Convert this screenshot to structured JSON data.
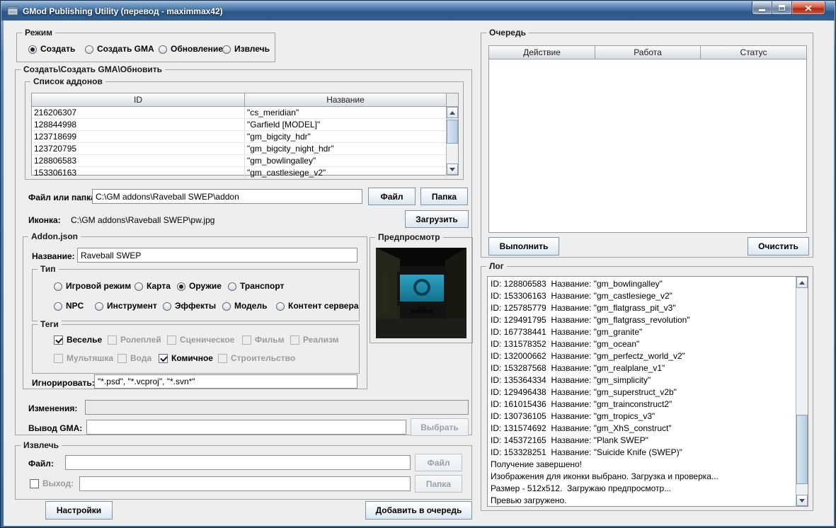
{
  "window": {
    "title": "GMod Publishing Utility (перевод - maximmax42)"
  },
  "colors": {
    "titlebar_blue": "#41709f",
    "close_red": "#c2402b",
    "panel": "#eeeeee",
    "accent_border": "#7e93a7",
    "scroll_thumb": "#b6cce3"
  },
  "mode": {
    "group_title": "Режим",
    "options": [
      {
        "label": "Создать",
        "selected": true
      },
      {
        "label": "Создать GMA",
        "selected": false
      },
      {
        "label": "Обновление",
        "selected": false
      },
      {
        "label": "Извлечь",
        "selected": false
      }
    ]
  },
  "create_section": {
    "group_title": "Создать\\Создать GMA\\Обновить",
    "addon_list": {
      "group_title": "Список аддонов",
      "columns": [
        "ID",
        "Название"
      ],
      "rows": [
        {
          "id": "216206307",
          "name": "\"cs_meridian\""
        },
        {
          "id": "128844998",
          "name": "\"Garfield [MODEL]\""
        },
        {
          "id": "123718699",
          "name": "\"gm_bigcity_hdr\""
        },
        {
          "id": "123720795",
          "name": "\"gm_bigcity_night_hdr\""
        },
        {
          "id": "128806583",
          "name": "\"gm_bowlingalley\""
        },
        {
          "id": "153306163",
          "name": "\"gm_castlesiege_v2\""
        }
      ]
    },
    "file_or_folder": {
      "label": "Файл или папка:",
      "value": "C:\\GM addons\\Raveball SWEP\\addon",
      "file_button": "Файл",
      "folder_button": "Папка"
    },
    "icon": {
      "label": "Иконка:",
      "value": "C:\\GM addons\\Raveball SWEP\\pw.jpg",
      "load_button": "Загрузить"
    },
    "addon_json": {
      "group_title": "Addon.json",
      "name_label": "Название:",
      "name_value": "Raveball SWEP",
      "type": {
        "group_title": "Тип",
        "row1": [
          {
            "label": "Игровой режим",
            "selected": false
          },
          {
            "label": "Карта",
            "selected": false
          },
          {
            "label": "Оружие",
            "selected": true
          },
          {
            "label": "Транспорт",
            "selected": false
          }
        ],
        "row2": [
          {
            "label": "NPC",
            "selected": false
          },
          {
            "label": "Инструмент",
            "selected": false
          },
          {
            "label": "Эффекты",
            "selected": false
          },
          {
            "label": "Модель",
            "selected": false
          },
          {
            "label": "Контент сервера",
            "selected": false
          }
        ]
      },
      "tags": {
        "group_title": "Теги",
        "row1": [
          {
            "label": "Веселье",
            "checked": true,
            "disabled": false
          },
          {
            "label": "Ролеплей",
            "checked": false,
            "disabled": true
          },
          {
            "label": "Сценическое",
            "checked": false,
            "disabled": true
          },
          {
            "label": "Фильм",
            "checked": false,
            "disabled": true
          },
          {
            "label": "Реализм",
            "checked": false,
            "disabled": true
          }
        ],
        "row2": [
          {
            "label": "Мультяшка",
            "checked": false,
            "disabled": true
          },
          {
            "label": "Вода",
            "checked": false,
            "disabled": true
          },
          {
            "label": "Комичное",
            "checked": true,
            "disabled": false
          },
          {
            "label": "Строительство",
            "checked": false,
            "disabled": true
          }
        ]
      },
      "ignore": {
        "label": "Игнорировать:",
        "value": "\"*.psd\", \"*.vcproj\", \"*.svn*\""
      }
    },
    "preview": {
      "group_title": "Предпросмотр"
    },
    "changes": {
      "label": "Изменения:",
      "value": ""
    },
    "gma_output": {
      "label": "Вывод GMA:",
      "value": "",
      "choose_button": "Выбрать"
    }
  },
  "extract_section": {
    "group_title": "Извлечь",
    "file": {
      "label": "Файл:",
      "value": "",
      "file_button": "Файл"
    },
    "output": {
      "label": "Выход:",
      "value": "",
      "folder_button": "Папка",
      "checkbox_checked": false
    }
  },
  "footer": {
    "settings_button": "Настройки",
    "add_to_queue_button": "Добавить в очередь"
  },
  "queue": {
    "group_title": "Очередь",
    "columns": [
      "Действие",
      "Работа",
      "Статус"
    ],
    "rows": [],
    "run_button": "Выполнить",
    "clear_button": "Очистить"
  },
  "log": {
    "group_title": "Лог",
    "lines": [
      "ID: 128806583  Название: \"gm_bowlingalley\"",
      "ID: 153306163  Название: \"gm_castlesiege_v2\"",
      "ID: 125785779  Название: \"gm_flatgrass_pit_v3\"",
      "ID: 129491795  Название: \"gm_flatgrass_revolution\"",
      "ID: 167738441  Название: \"gm_granite\"",
      "ID: 131578352  Название: \"gm_ocean\"",
      "ID: 132000662  Название: \"gm_perfectz_world_v2\"",
      "ID: 153287568  Название: \"gm_realplane_v1\"",
      "ID: 135364334  Название: \"gm_simplicity\"",
      "ID: 129496438  Название: \"gm_superstruct_v2b\"",
      "ID: 161015436  Название: \"gm_trainconstruct2\"",
      "ID: 130736105  Название: \"gm_tropics_v3\"",
      "ID: 131574692  Название: \"gm_XhS_construct\"",
      "ID: 145372165  Название: \"Plank SWEP\"",
      "ID: 153328251  Название: \"Suicide Knife (SWEP)\"",
      "Получение завершено!",
      "Изображения для иконки выбрано. Загрузка и проверка...",
      "Размер - 512x512.  Загружаю предпросмотр...",
      "Превью загружено."
    ]
  }
}
